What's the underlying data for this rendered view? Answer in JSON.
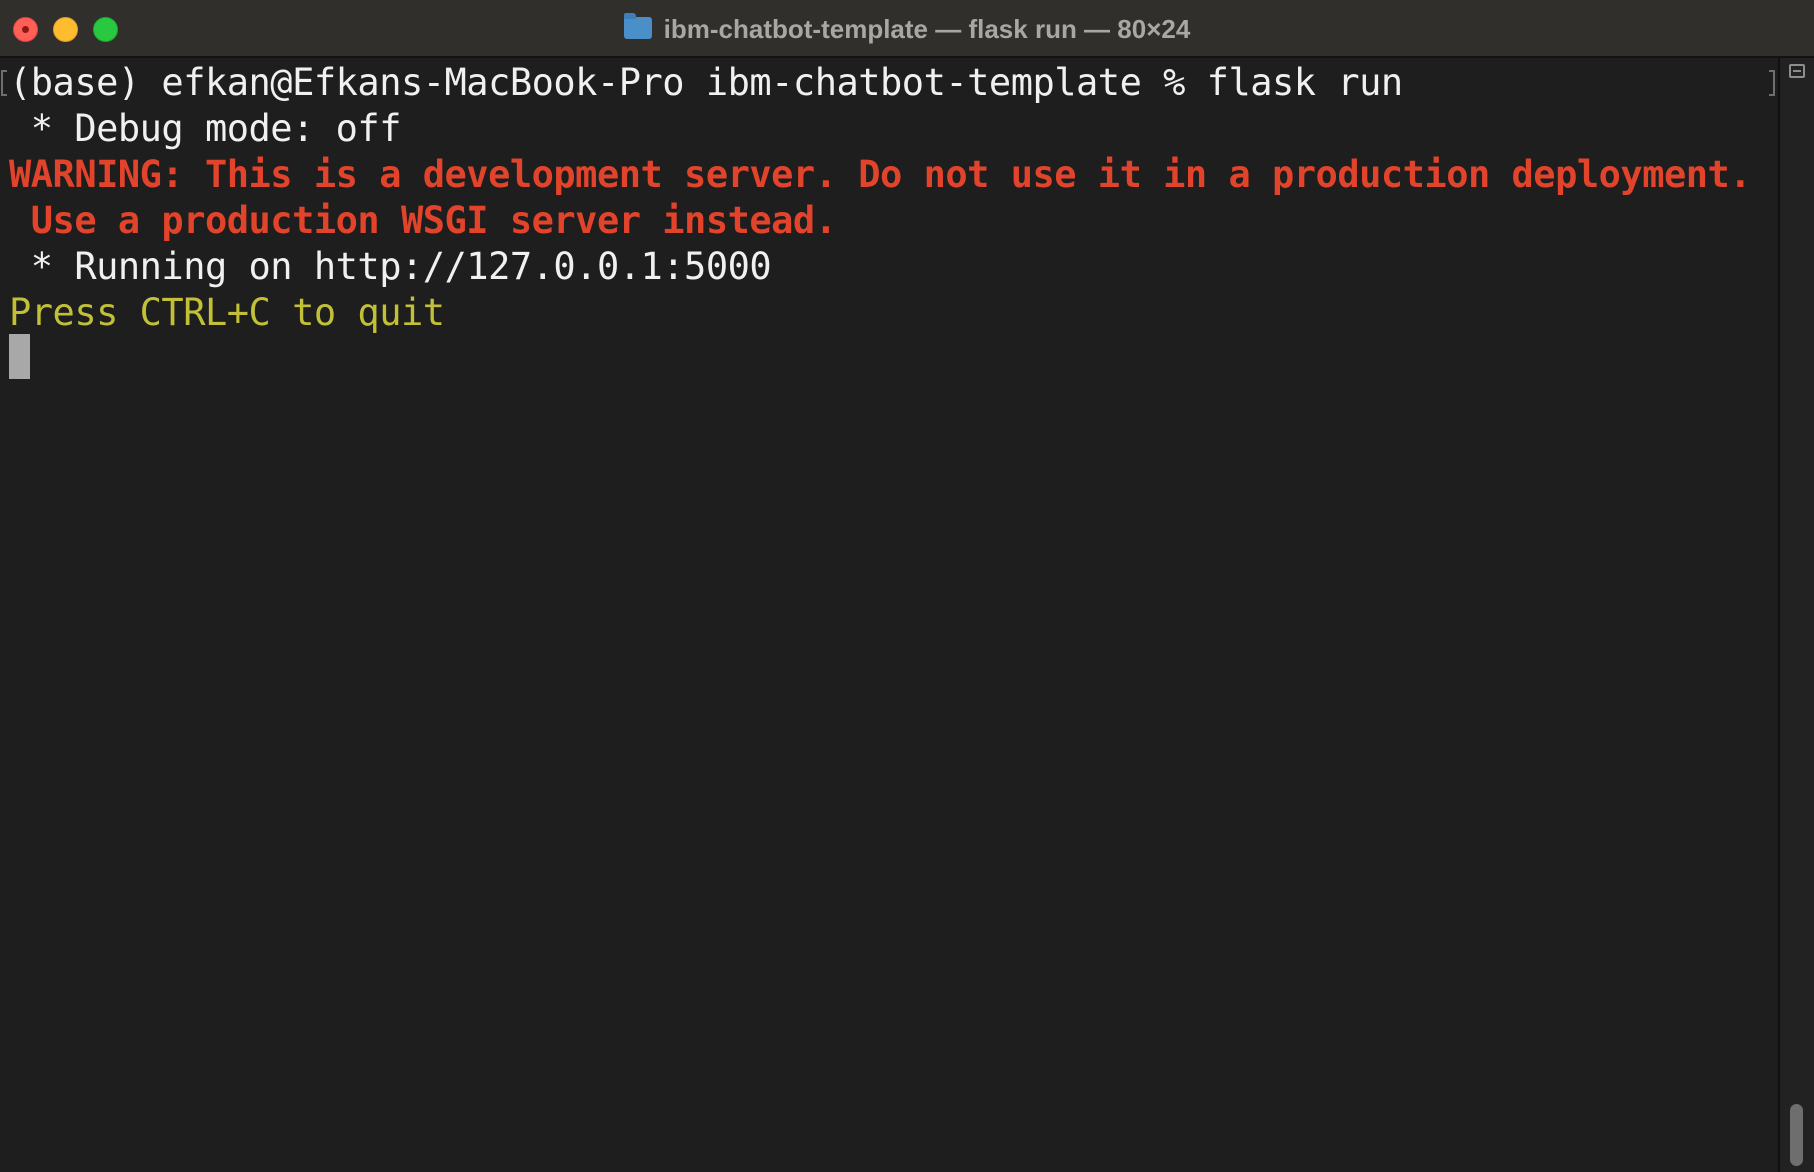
{
  "window": {
    "title": "ibm-chatbot-template — flask run — 80×24",
    "title_icon": "folder-icon"
  },
  "colors": {
    "background": "#1e1e1e",
    "foreground": "#f0f0f0",
    "warning_red": "#e2432b",
    "hint_yellow": "#c2c036"
  },
  "terminal": {
    "lines": [
      {
        "text": "(base) efkan@Efkans-MacBook-Pro ibm-chatbot-template % flask run",
        "color": "white"
      },
      {
        "text": " * Debug mode: off",
        "color": "white"
      },
      {
        "text": "WARNING: This is a development server. Do not use it in a production deployment.",
        "color": "red"
      },
      {
        "text": " Use a production WSGI server instead.",
        "color": "red"
      },
      {
        "text": " * Running on http://127.0.0.1:5000",
        "color": "white"
      },
      {
        "text": "Press CTRL+C to quit",
        "color": "yellow"
      }
    ]
  }
}
